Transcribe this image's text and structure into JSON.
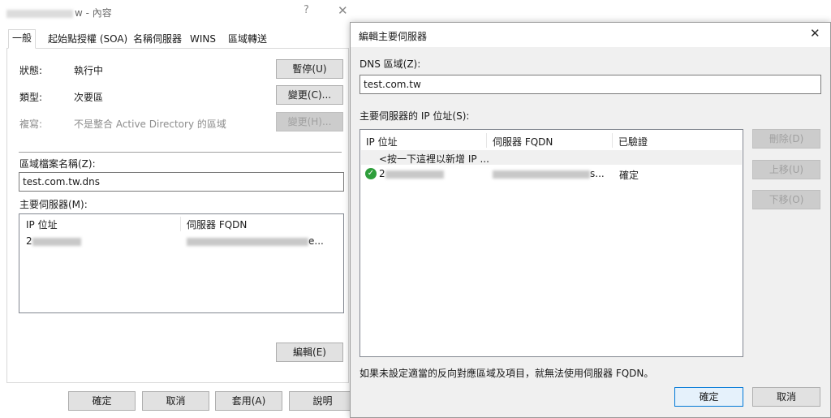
{
  "bg_window": {
    "title_suffix": "w - 內容",
    "help_glyph": "?",
    "close_glyph": "✕",
    "tabs": [
      "一般",
      "起始點授權 (SOA)",
      "名稱伺服器",
      "WINS",
      "區域轉送"
    ],
    "status_label": "狀態:",
    "status_value": "執行中",
    "type_label": "類型:",
    "type_value": "次要區",
    "replication_label": "複寫:",
    "replication_value": "不是整合 Active Directory 的區域",
    "pause_button": "暫停(U)",
    "change_type_button": "變更(C)...",
    "change_repl_button": "變更(H)...",
    "zone_file_label": "區域檔案名稱(Z):",
    "zone_file_value": "test.com.tw.dns",
    "masters_label": "主要伺服器(M):",
    "col_ip": "IP 位址",
    "col_fqdn": "伺服器 FQDN",
    "row_ip_prefix": "2",
    "row_fqdn_suffix": "e...",
    "edit_button": "編輯(E)",
    "ok_button": "確定",
    "cancel_button": "取消",
    "apply_button": "套用(A)",
    "help_button": "說明"
  },
  "dialog": {
    "title": "編輯主要伺服器",
    "close_glyph": "✕",
    "dns_zone_label": "DNS 區域(Z):",
    "dns_zone_value": "test.com.tw",
    "ip_list_label": "主要伺服器的 IP 位址(S):",
    "col_ip": "IP 位址",
    "col_fqdn": "伺服器 FQDN",
    "col_validated": "已驗證",
    "add_row_hint": "<按一下這裡以新增 IP ...",
    "row_ip_prefix": "2",
    "row_fqdn_suffix": "s...",
    "row_validated": "確定",
    "delete_button": "刪除(D)",
    "move_up_button": "上移(U)",
    "move_down_button": "下移(O)",
    "footer_note": "如果未設定適當的反向對應區域及項目，就無法使用伺服器 FQDN。",
    "ok_button": "確定",
    "cancel_button": "取消"
  },
  "icons": {
    "validated": "check-circle-icon"
  },
  "colors": {
    "validated_green": "#2e9e3b",
    "focus_blue": "#0078d7",
    "disabled_text": "#a0a0a0"
  }
}
